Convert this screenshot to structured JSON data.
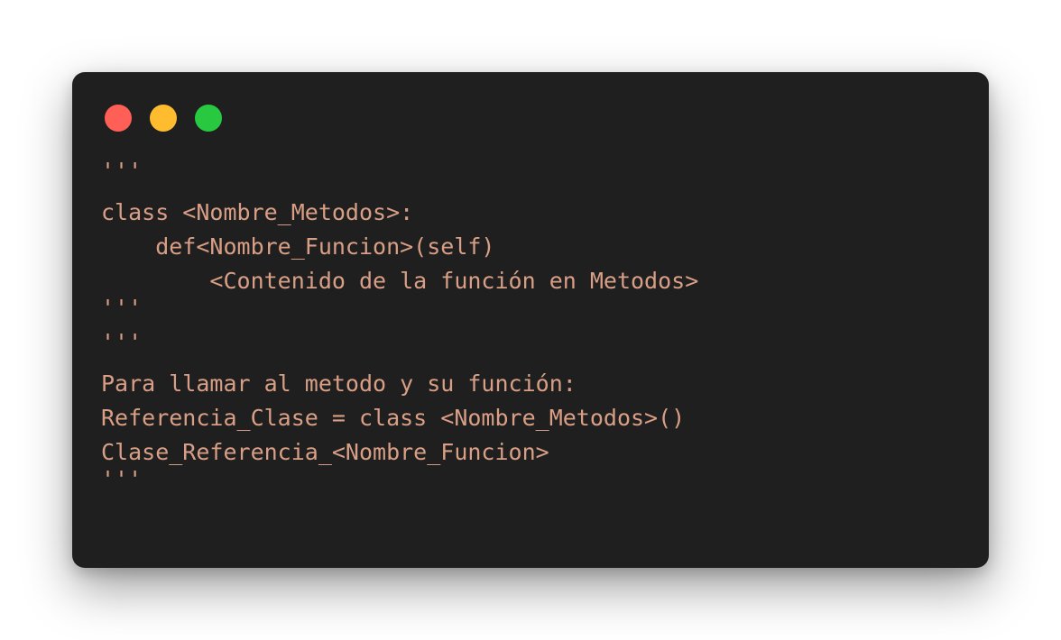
{
  "window": {
    "colors": {
      "background": "#1f1f1f",
      "close": "#ff5f57",
      "minimize": "#febc2e",
      "maximize": "#28c840",
      "text": "#d99f86"
    }
  },
  "code": {
    "lines": [
      "'''",
      "class <Nombre_Metodos>:",
      "    def<Nombre_Funcion>(self)",
      "        <Contenido de la función en Metodos>",
      "'''",
      "'''",
      "Para llamar al metodo y su función:",
      "Referencia_Clase = class <Nombre_Metodos>()",
      "Clase_Referencia_<Nombre_Funcion>",
      "'''"
    ]
  }
}
